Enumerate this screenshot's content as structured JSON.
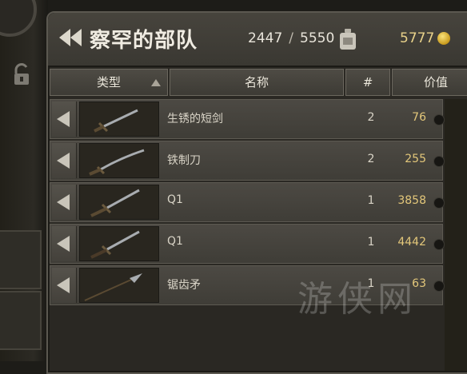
{
  "header": {
    "title": "察罕的部队",
    "weight_current": "2447",
    "weight_separator": "/",
    "weight_max": "5550",
    "gold": "5777",
    "weight_icon": "weight-icon",
    "gold_icon": "coin-icon",
    "back_icon": "double-left-arrow-icon"
  },
  "columns": {
    "type": "类型",
    "name": "名称",
    "count": "#",
    "value": "价值"
  },
  "items": [
    {
      "name": "生锈的短剑",
      "count": "2",
      "value": "76",
      "icon": "short-sword-icon"
    },
    {
      "name": "铁制刀",
      "count": "2",
      "value": "255",
      "icon": "saber-icon"
    },
    {
      "name": "Q1",
      "count": "1",
      "value": "3858",
      "icon": "longsword-icon"
    },
    {
      "name": "Q1",
      "count": "1",
      "value": "4442",
      "icon": "longsword-icon"
    },
    {
      "name": "锯齿矛",
      "count": "1",
      "value": "63",
      "icon": "spear-icon"
    }
  ],
  "watermark": "游侠网",
  "colors": {
    "value_text": "#e3c77a",
    "gold_text": "#e8d28a",
    "panel_bg": "#2a2823"
  }
}
